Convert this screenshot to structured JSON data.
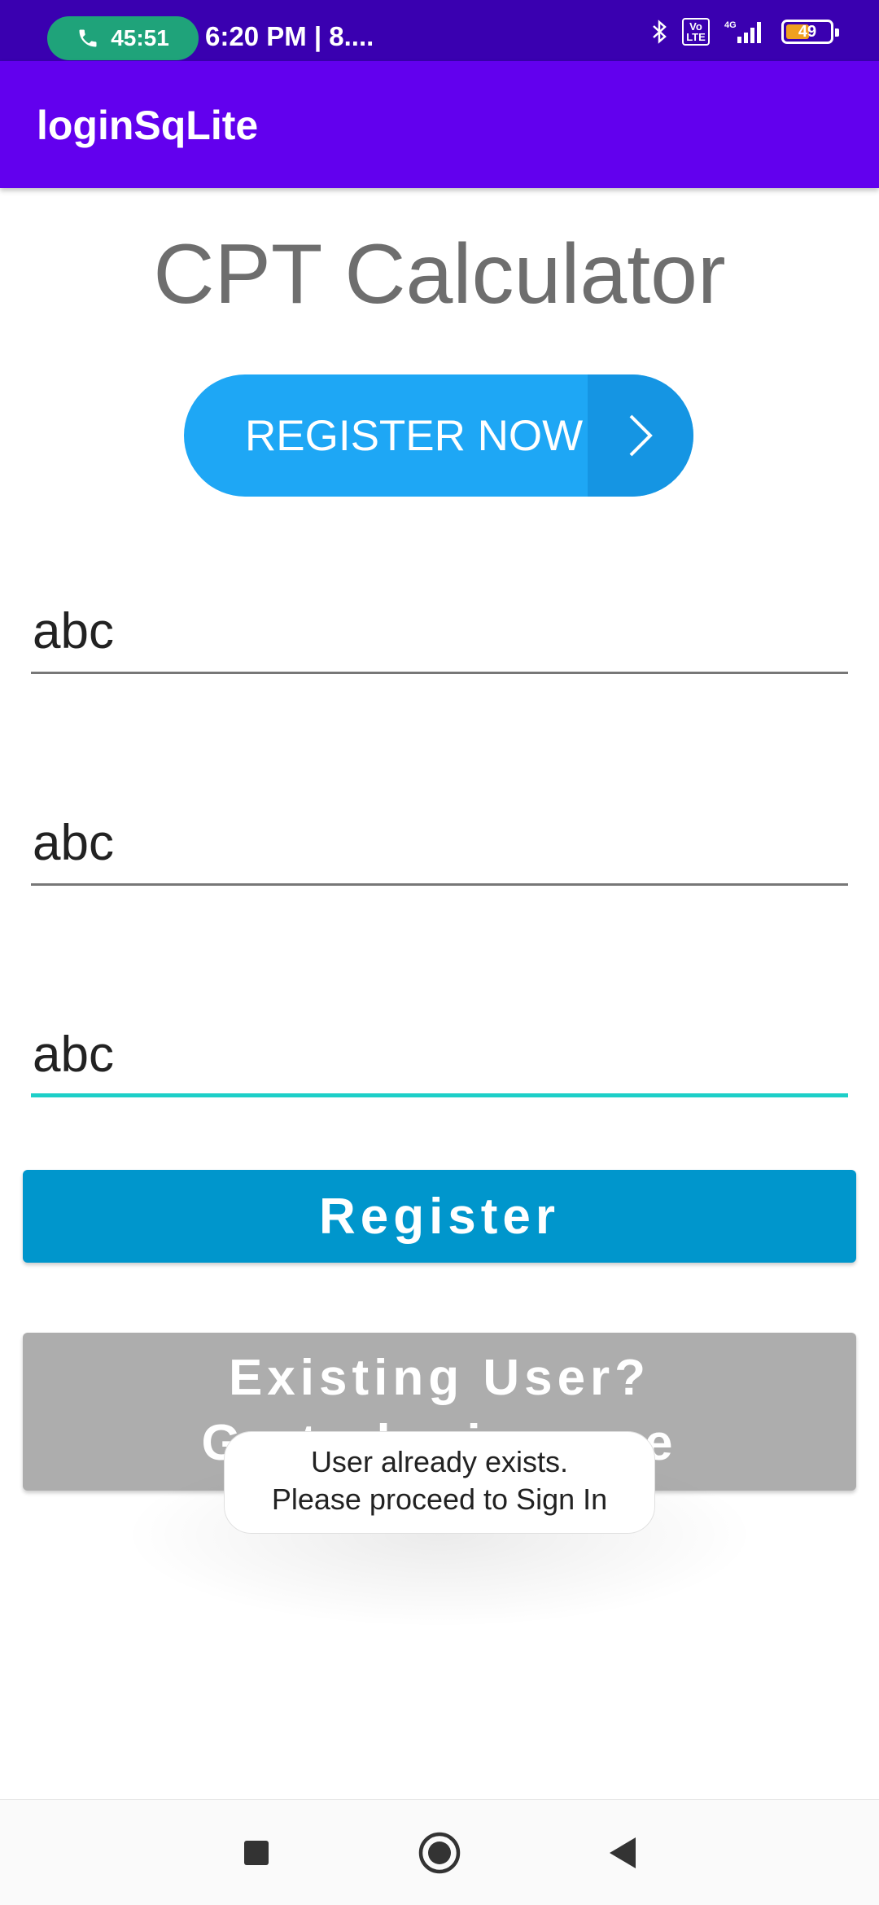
{
  "status_bar": {
    "call_timer": "45:51",
    "time_text": "6:20 PM | 8....",
    "volte_label": "Vo LTE",
    "network_label": "4G",
    "battery_level": "49",
    "battery_color": "#f0a020"
  },
  "app_bar": {
    "title": "loginSqLite",
    "color": "#6200ee"
  },
  "content": {
    "heading": "CPT Calculator",
    "register_now_banner": "REGISTER NOW",
    "fields": [
      {
        "value": "abc",
        "focused": false
      },
      {
        "value": "abc",
        "focused": false
      },
      {
        "value": "abc",
        "focused": true
      }
    ],
    "register_button": "Register",
    "existing_user_line1": "Existing User?",
    "existing_user_line2": "Go to login page"
  },
  "toast": {
    "line1": "User already exists.",
    "line2": "Please proceed to Sign In"
  },
  "nav_bar": {
    "recents_icon": "square-icon",
    "home_icon": "circle-icon",
    "back_icon": "triangle-back-icon"
  }
}
